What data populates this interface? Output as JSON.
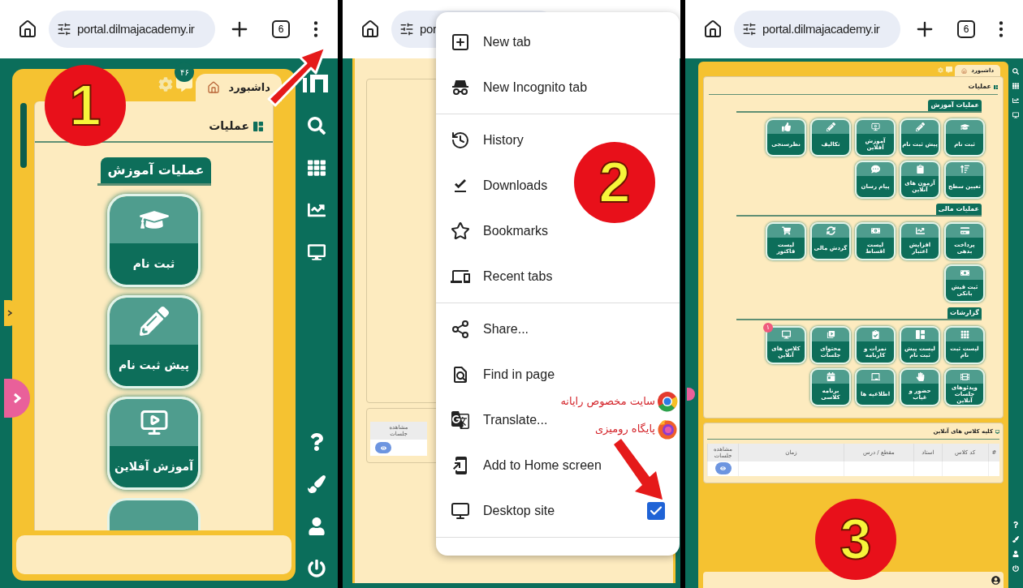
{
  "panel_1": {
    "browser": {
      "url": "portal.dilmajacademy.ir",
      "tab_count": "6"
    },
    "step": "1",
    "dashboard_tab": "داشبورد",
    "messages_badge": "۴۶",
    "section_title": "عملیات",
    "group_title": "عملیات آموزش",
    "tiles": [
      {
        "label": "ثبت نام"
      },
      {
        "label": "پیش ثبت نام"
      },
      {
        "label": "آموزش آفلاین"
      }
    ]
  },
  "panel_2": {
    "browser": {
      "url": "por"
    },
    "step": "2",
    "menu": [
      [
        {
          "kind": "action",
          "label": "New tab"
        },
        {
          "kind": "action",
          "label": "New Incognito tab"
        }
      ],
      [
        {
          "kind": "action",
          "label": "History"
        },
        {
          "kind": "action",
          "label": "Downloads"
        },
        {
          "kind": "action",
          "label": "Bookmarks"
        },
        {
          "kind": "action",
          "label": "Recent tabs"
        }
      ],
      [
        {
          "kind": "action",
          "label": "Share..."
        },
        {
          "kind": "action",
          "label": "Find in page"
        },
        {
          "kind": "action",
          "label": "Translate..."
        },
        {
          "kind": "action",
          "label": "Add to Home screen"
        },
        {
          "kind": "toggle",
          "label": "Desktop site",
          "checked": true
        }
      ]
    ],
    "annotations": [
      "سایت مخصوص رایانه",
      "پایگاه رومیزی"
    ],
    "background_table_column": "مشاهده جلسات"
  },
  "panel_3": {
    "browser": {
      "url": "portal.dilmajacademy.ir",
      "tab_count": "6"
    },
    "step": "3",
    "dashboard_tab": "داشبورد",
    "section_title": "عملیات",
    "groups": [
      {
        "title": "عملیات آموزش",
        "tiles": [
          {
            "label": "ثبت نام"
          },
          {
            "label": "پیش ثبت نام"
          },
          {
            "label": "آموزش آفلاین"
          },
          {
            "label": "تکالیف"
          },
          {
            "label": "نظرسنجی"
          },
          {
            "label": "تعیین سطح"
          },
          {
            "label": "آزمون های آنلاین"
          },
          {
            "label": "پیام رسان"
          }
        ]
      },
      {
        "title": "عملیات مالی",
        "tiles": [
          {
            "label": "پرداخت بدهی"
          },
          {
            "label": "افزایش اعتبار"
          },
          {
            "label": "لیست اقساط"
          },
          {
            "label": "گردش مالی"
          },
          {
            "label": "لیست فاکتور"
          },
          {
            "label": "ثبت فیش بانکی"
          }
        ]
      },
      {
        "title": "گزارشات",
        "tiles": [
          {
            "label": "لیست ثبت نام"
          },
          {
            "label": "لیست پیش ثبت نام"
          },
          {
            "label": "نمرات و کارنامه"
          },
          {
            "label": "محتوای جلسات"
          },
          {
            "label": "کلاس های آنلاین",
            "badge": "۱"
          },
          {
            "label": "ویدئوهای جلسات آنلاین"
          },
          {
            "label": "حضور و غیاب"
          },
          {
            "label": "اطلاعیه ها"
          },
          {
            "label": "برنامه کلاسی"
          }
        ]
      }
    ],
    "table": {
      "title": "کلیه کلاس های آنلاین",
      "columns": [
        "#",
        "کد کلاس",
        "استاد",
        "مقطع / درس",
        "زمان",
        "مشاهده جلسات"
      ]
    }
  }
}
